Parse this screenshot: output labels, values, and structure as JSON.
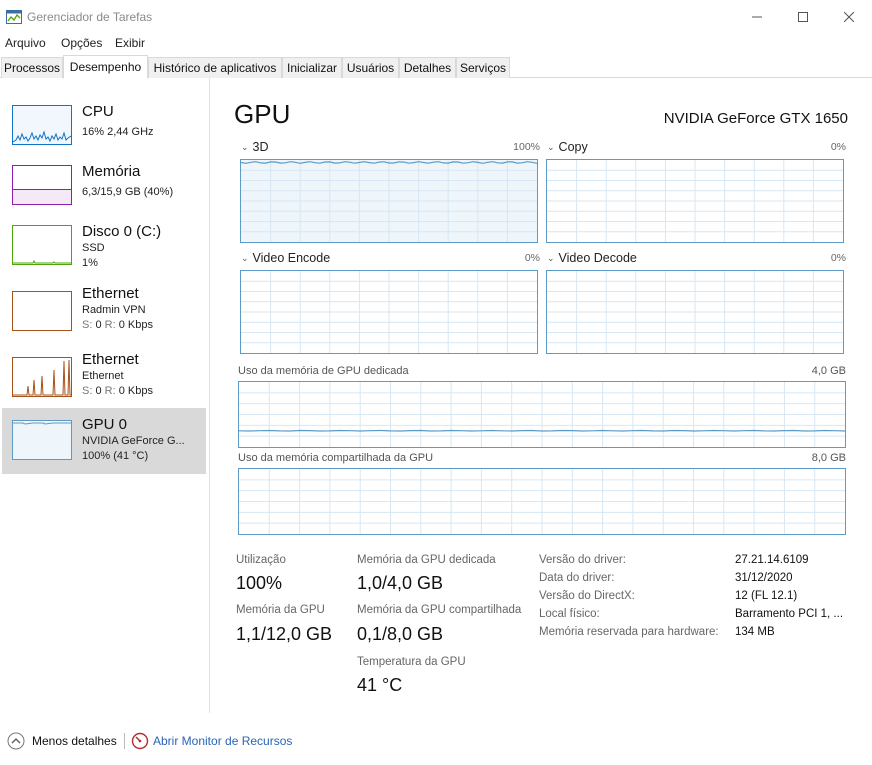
{
  "window": {
    "title": "Gerenciador de Tarefas"
  },
  "menu": {
    "items": [
      "Arquivo",
      "Opções",
      "Exibir"
    ]
  },
  "tabs": [
    {
      "label": "Processos",
      "active": false
    },
    {
      "label": "Desempenho",
      "active": true
    },
    {
      "label": "Histórico de aplicativos",
      "active": false
    },
    {
      "label": "Inicializar",
      "active": false
    },
    {
      "label": "Usuários",
      "active": false
    },
    {
      "label": "Detalhes",
      "active": false
    },
    {
      "label": "Serviços",
      "active": false
    }
  ],
  "sidebar": {
    "items": [
      {
        "title": "CPU",
        "lines": [
          "16% 2,44 GHz"
        ],
        "color": "#1174c7",
        "selected": false
      },
      {
        "title": "Memória",
        "lines": [
          "6,3/15,9 GB (40%)"
        ],
        "color": "#8e1fac",
        "selected": false
      },
      {
        "title": "Disco 0 (C:)",
        "lines": [
          "SSD",
          "1%"
        ],
        "color": "#4da60c",
        "selected": false
      },
      {
        "title": "Ethernet",
        "lines": [
          "Radmin VPN"
        ],
        "send_label": "S:",
        "send_value": "0",
        "recv_label": "R:",
        "recv_value": "0 Kbps",
        "color": "#a7521b",
        "selected": false
      },
      {
        "title": "Ethernet",
        "lines": [
          "Ethernet"
        ],
        "send_label": "S:",
        "send_value": "0",
        "recv_label": "R:",
        "recv_value": "0 Kbps",
        "color": "#a7521b",
        "selected": false
      },
      {
        "title": "GPU 0",
        "lines": [
          "NVIDIA GeForce G...",
          "100% (41 °C)"
        ],
        "color": "#5e9ac6",
        "selected": true
      }
    ]
  },
  "main": {
    "title": "GPU",
    "model": "NVIDIA GeForce GTX 1650",
    "engines": [
      {
        "name": "3D",
        "percent": "100%",
        "level": 0.97
      },
      {
        "name": "Copy",
        "percent": "0%",
        "level": 0.0
      },
      {
        "name": "Video Encode",
        "percent": "0%",
        "level": 0.0
      },
      {
        "name": "Video Decode",
        "percent": "0%",
        "level": 0.0
      }
    ],
    "dedicated_memory": {
      "label": "Uso da memória de GPU dedicada",
      "max": "4,0 GB",
      "level": 0.25
    },
    "shared_memory": {
      "label": "Uso da memória compartilhada da GPU",
      "max": "8,0 GB",
      "level": 0.0
    },
    "stats": {
      "utilization": {
        "label": "Utilização",
        "value": "100%"
      },
      "gpu_memory": {
        "label": "Memória da GPU",
        "value": "1,1/12,0 GB"
      },
      "dedicated": {
        "label": "Memória da GPU dedicada",
        "value": "1,0/4,0 GB"
      },
      "shared": {
        "label": "Memória da GPU compartilhada",
        "value": "0,1/8,0 GB"
      },
      "temperature": {
        "label": "Temperatura da GPU",
        "value": "41 °C"
      }
    },
    "info": [
      {
        "key": "Versão do driver:",
        "value": "27.21.14.6109"
      },
      {
        "key": "Data do driver:",
        "value": "31/12/2020"
      },
      {
        "key": "Versão do DirectX:",
        "value": "12 (FL 12.1)"
      },
      {
        "key": "Local físico:",
        "value": "Barramento PCI 1, ..."
      },
      {
        "key": "Memória reservada para hardware:",
        "value": "134 MB"
      }
    ]
  },
  "footer": {
    "less_details": "Menos detalhes",
    "resource_monitor": "Abrir Monitor de Recursos"
  },
  "colors": {
    "gpu_accent": "#5e9ac6",
    "link": "#2a64b5"
  }
}
